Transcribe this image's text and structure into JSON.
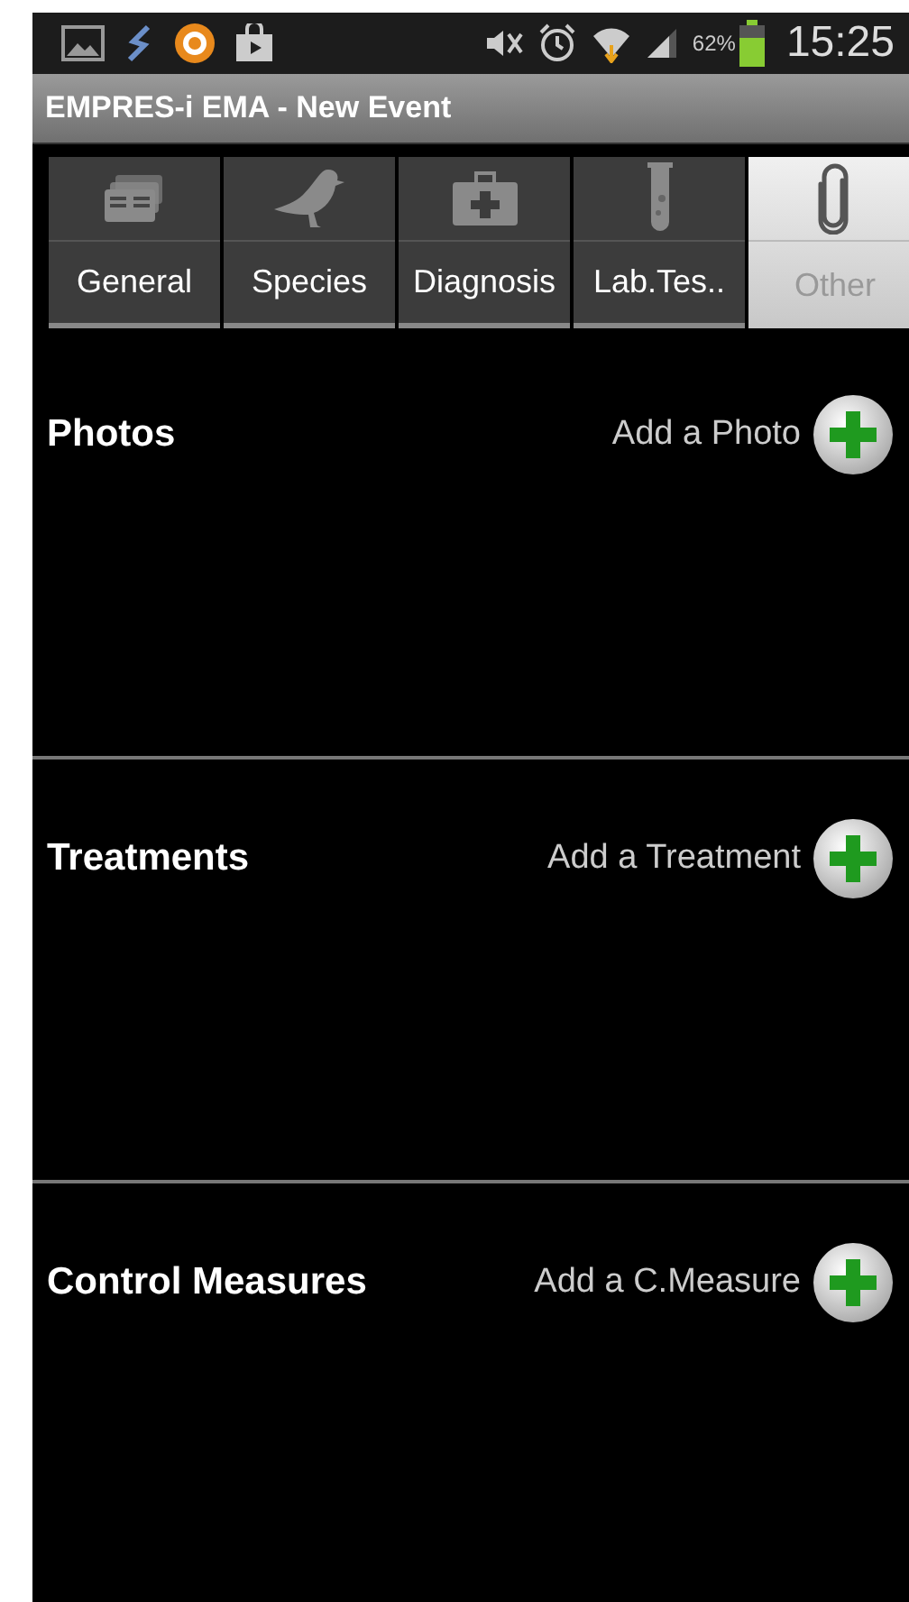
{
  "status_bar": {
    "battery": "62%",
    "time": "15:25"
  },
  "window": {
    "title": "EMPRES-i EMA - New Event"
  },
  "tabs": [
    {
      "label": "General",
      "selected": false
    },
    {
      "label": "Species",
      "selected": false
    },
    {
      "label": "Diagnosis",
      "selected": false
    },
    {
      "label": "Lab.Tes..",
      "selected": false
    },
    {
      "label": "Other",
      "selected": true
    }
  ],
  "sections": [
    {
      "title": "Photos",
      "action": "Add a Photo"
    },
    {
      "title": "Treatments",
      "action": "Add a Treatment"
    },
    {
      "title": "Control Measures",
      "action": "Add a C.Measure"
    }
  ]
}
